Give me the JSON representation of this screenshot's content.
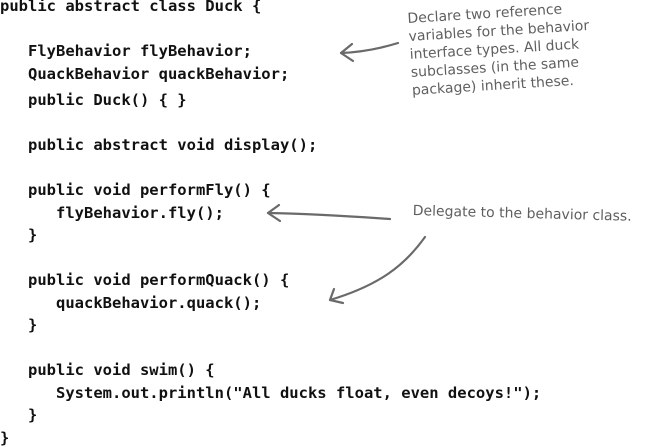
{
  "code": {
    "lines": [
      "public abstract class Duck {",
      "   FlyBehavior flyBehavior;",
      "   QuackBehavior quackBehavior;",
      "   public Duck() { }",
      "   public abstract void display();",
      "   public void performFly() {",
      "      flyBehavior.fly();",
      "   }",
      "   public void performQuack() {",
      "      quackBehavior.quack();",
      "   }",
      "   public void swim() {",
      "      System.out.println(\"All ducks float, even decoys!\");",
      "   }",
      "}"
    ]
  },
  "annotations": {
    "declare": {
      "lines": [
        "Declare two reference",
        "variables for the behavior",
        "interface types. All duck",
        "subclasses (in the same",
        "package) inherit these."
      ]
    },
    "delegate": {
      "text": "Delegate to the behavior class."
    }
  },
  "colors": {
    "code": "#111111",
    "annotation": "#5f5f5f",
    "arrow": "#6a6a6a"
  }
}
